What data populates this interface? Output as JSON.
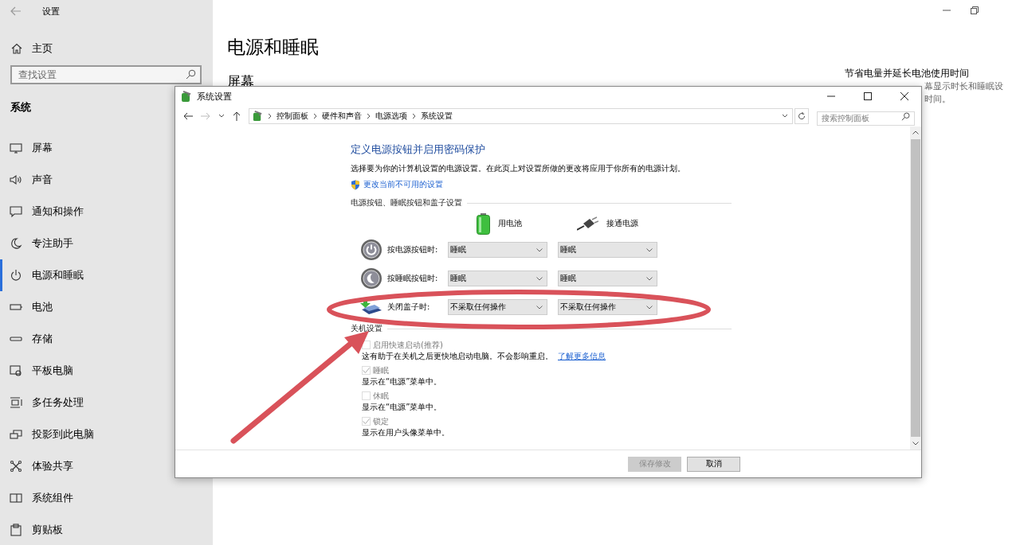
{
  "settings_window": {
    "title": "设置"
  },
  "sidebar": {
    "home": "主页",
    "search": {
      "placeholder": "查找设置"
    },
    "section": "系统",
    "items": [
      {
        "label": "屏幕",
        "selected": false
      },
      {
        "label": "声音",
        "selected": false
      },
      {
        "label": "通知和操作",
        "selected": false
      },
      {
        "label": "专注助手",
        "selected": false
      },
      {
        "label": "电源和睡眠",
        "selected": true
      },
      {
        "label": "电池",
        "selected": false
      },
      {
        "label": "存储",
        "selected": false
      },
      {
        "label": "平板电脑",
        "selected": false
      },
      {
        "label": "多任务处理",
        "selected": false
      },
      {
        "label": "投影到此电脑",
        "selected": false
      },
      {
        "label": "体验共享",
        "selected": false
      },
      {
        "label": "系统组件",
        "selected": false
      },
      {
        "label": "剪贴板",
        "selected": false
      }
    ]
  },
  "main": {
    "title": "电源和睡眠",
    "section": "屏幕",
    "side_heading": "节省电量并延长电池使用时间",
    "side_lines": [
      "幕显示时长和睡眠设",
      "时间。"
    ]
  },
  "dialog": {
    "title": "系统设置",
    "breadcrumb": [
      "控制面板",
      "硬件和声音",
      "电源选项",
      "系统设置"
    ],
    "search": {
      "placeholder": "搜索控制面板"
    },
    "heading": "定义电源按钮并启用密码保护",
    "description": "选择要为你的计算机设置的电源设置。在此页上对设置所做的更改将应用于你所有的电源计划。",
    "admin_link": "更改当前不可用的设置",
    "group_buttons": "电源按钮、睡眠按钮和盖子设置",
    "columns": [
      "用电池",
      "接通电源"
    ],
    "rows": [
      {
        "label": "按电源按钮时:",
        "battery": "睡眠",
        "plugged": "睡眠"
      },
      {
        "label": "按睡眠按钮时:",
        "battery": "睡眠",
        "plugged": "睡眠"
      },
      {
        "label": "关闭盖子时:",
        "battery": "不采取任何操作",
        "plugged": "不采取任何操作"
      }
    ],
    "group_shutdown": "关机设置",
    "options": [
      {
        "label": "启用快速启动(推荐)",
        "checked": false,
        "disabled": true,
        "description": "这有助于在关机之后更快地启动电脑。不会影响重启。",
        "link": "了解更多信息"
      },
      {
        "label": "睡眠",
        "checked": true,
        "disabled": true,
        "description": "显示在“电源”菜单中。"
      },
      {
        "label": "休眠",
        "checked": false,
        "disabled": true,
        "description": "显示在“电源”菜单中。"
      },
      {
        "label": "锁定",
        "checked": true,
        "disabled": true,
        "description": "显示在用户头像菜单中。"
      }
    ],
    "buttons": [
      {
        "label": "保存修改",
        "disabled": true
      },
      {
        "label": "取消",
        "disabled": false
      }
    ]
  }
}
